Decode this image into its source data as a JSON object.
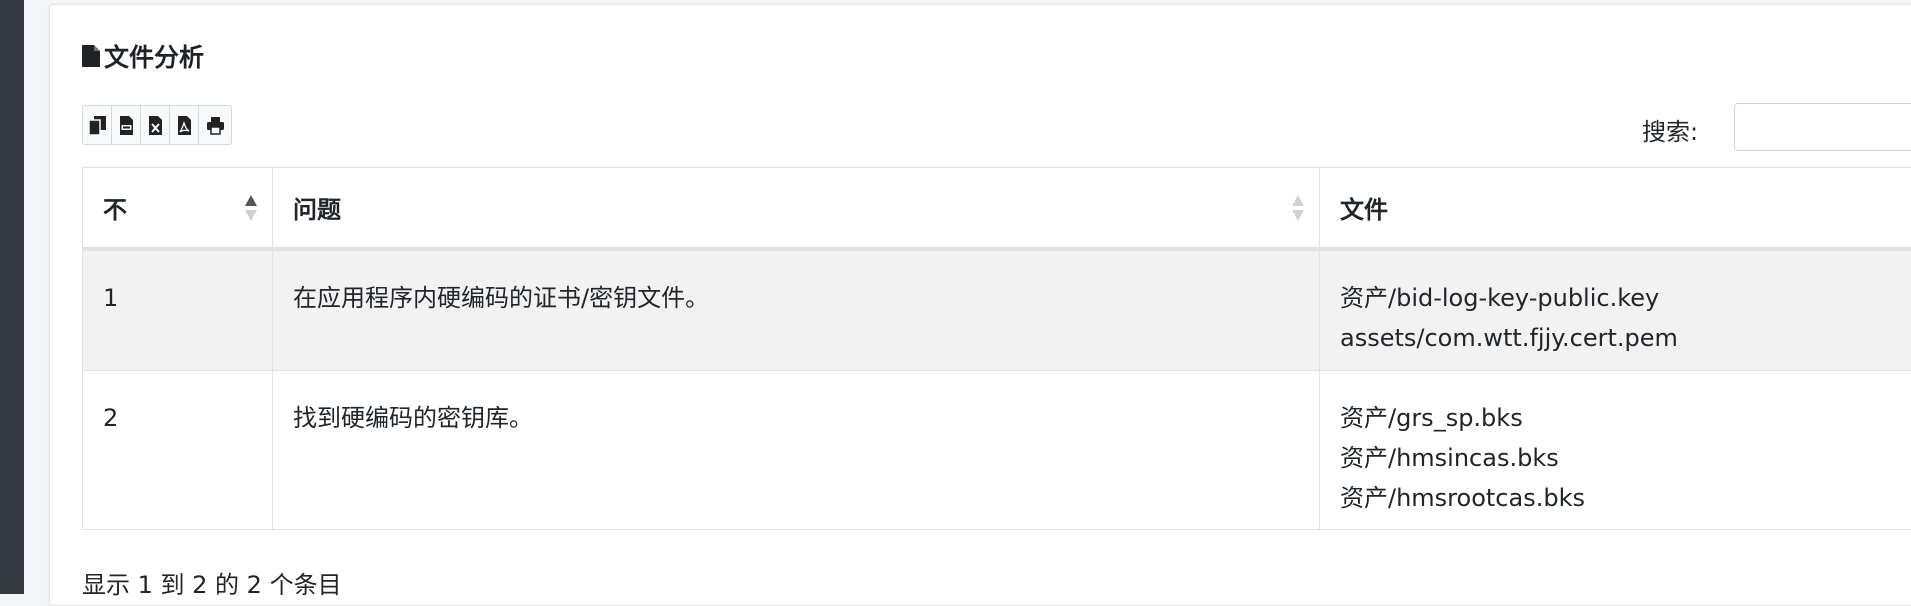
{
  "section": {
    "title": "文件分析"
  },
  "toolbar": {
    "buttons": [
      {
        "name": "copy",
        "icon": "copy-icon"
      },
      {
        "name": "csv",
        "icon": "csv-file-icon"
      },
      {
        "name": "excel",
        "icon": "excel-file-icon"
      },
      {
        "name": "pdf",
        "icon": "pdf-file-icon"
      },
      {
        "name": "print",
        "icon": "print-icon"
      }
    ]
  },
  "search": {
    "label": "搜索:",
    "value": ""
  },
  "table": {
    "headers": [
      "不",
      "问题",
      "文件"
    ],
    "rows": [
      {
        "num": "1",
        "issue": "在应用程序内硬编码的证书/密钥文件。",
        "files": [
          "资产/bid-log-key-public.key",
          "assets/com.wtt.fjjy.cert.pem"
        ]
      },
      {
        "num": "2",
        "issue": "找到硬编码的密钥库。",
        "files": [
          "资产/grs_sp.bks",
          "资产/hmsincas.bks",
          "资产/hmsrootcas.bks"
        ]
      }
    ]
  },
  "footer": {
    "info": "显示 1 到 2 的 2 个条目"
  },
  "colors": {
    "sidebar": "#343a40",
    "striped_row": "#f2f2f2",
    "border": "#dee2e6"
  }
}
